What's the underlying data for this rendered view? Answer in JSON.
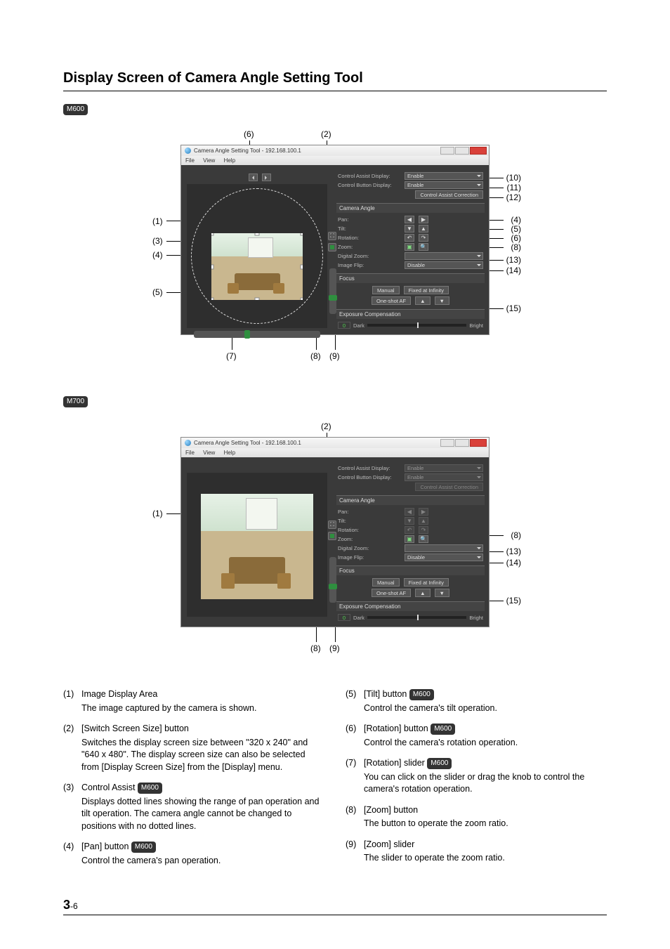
{
  "title": "Display Screen of Camera Angle Setting Tool",
  "badges": {
    "m600": "M600",
    "m700": "M700"
  },
  "window": {
    "title": "Camera Angle Setting Tool - 192.168.100.1",
    "menus": [
      "File",
      "View",
      "Help"
    ],
    "controlAssistDisplay": {
      "label": "Control Assist Display:",
      "value": "Enable"
    },
    "controlButtonDisplay": {
      "label": "Control Button Display:",
      "value": "Enable"
    },
    "controlAssistCorrection": "Control Assist Correction",
    "sections": {
      "cameraAngle": "Camera Angle",
      "focus": "Focus",
      "exposure": "Exposure Compensation"
    },
    "pan": {
      "label": "Pan:"
    },
    "tilt": {
      "label": "Tilt:"
    },
    "rotation": {
      "label": "Rotation:"
    },
    "zoom": {
      "label": "Zoom:"
    },
    "digitalZoom": {
      "label": "Digital Zoom:"
    },
    "imageFlip": {
      "label": "Image Flip:",
      "value": "Disable"
    },
    "focusButtons": {
      "manual": "Manual",
      "infinity": "Fixed at Infinity",
      "oneshot": "One-shot AF"
    },
    "exposure": {
      "value": "0",
      "dark": "Dark",
      "bright": "Bright"
    }
  },
  "top_callouts_m600": {
    "top": {
      "c6": "(6)",
      "c2": "(2)"
    },
    "left": {
      "c1": "(1)",
      "c3": "(3)",
      "c4": "(4)",
      "c5": "(5)"
    },
    "right": {
      "c10": "(10)",
      "c11": "(11)",
      "c12": "(12)",
      "c4": "(4)",
      "c5": "(5)",
      "c6": "(6)",
      "c8": "(8)",
      "c13": "(13)",
      "c14": "(14)",
      "c15": "(15)"
    },
    "bottom": {
      "c7": "(7)",
      "c8": "(8)",
      "c9": "(9)"
    }
  },
  "top_callouts_m700": {
    "top": {
      "c2": "(2)"
    },
    "left": {
      "c1": "(1)"
    },
    "right": {
      "c8": "(8)",
      "c13": "(13)",
      "c14": "(14)",
      "c15": "(15)"
    },
    "bottom": {
      "c8": "(8)",
      "c9": "(9)"
    }
  },
  "list_left": [
    {
      "num": "(1)",
      "head": "Image Display Area",
      "badge": null,
      "desc": "The image captured by the camera is shown."
    },
    {
      "num": "(2)",
      "head": "[Switch Screen Size] button",
      "badge": null,
      "desc": "Switches the display screen size between \"320 x 240\" and \"640 x 480\". The display screen size can also be selected from [Display Screen Size] from the [Display] menu."
    },
    {
      "num": "(3)",
      "head": "Control Assist",
      "badge": "M600",
      "desc": "Displays dotted lines showing the range of pan operation and tilt operation. The camera angle cannot be changed to positions with no dotted lines."
    },
    {
      "num": "(4)",
      "head": "[Pan] button",
      "badge": "M600",
      "desc": "Control the camera's pan operation."
    }
  ],
  "list_right": [
    {
      "num": "(5)",
      "head": "[Tilt] button",
      "badge": "M600",
      "desc": "Control the camera's tilt operation."
    },
    {
      "num": "(6)",
      "head": "[Rotation] button",
      "badge": "M600",
      "desc": "Control the camera's rotation operation."
    },
    {
      "num": "(7)",
      "head": "[Rotation] slider",
      "badge": "M600",
      "desc": "You can click on the slider or drag the knob to control the camera's rotation operation."
    },
    {
      "num": "(8)",
      "head": "[Zoom] button",
      "badge": null,
      "desc": "The button to operate the zoom ratio."
    },
    {
      "num": "(9)",
      "head": "[Zoom] slider",
      "badge": null,
      "desc": "The slider to operate the zoom ratio."
    }
  ],
  "page_num": {
    "chapter": "3",
    "page": "-6"
  }
}
